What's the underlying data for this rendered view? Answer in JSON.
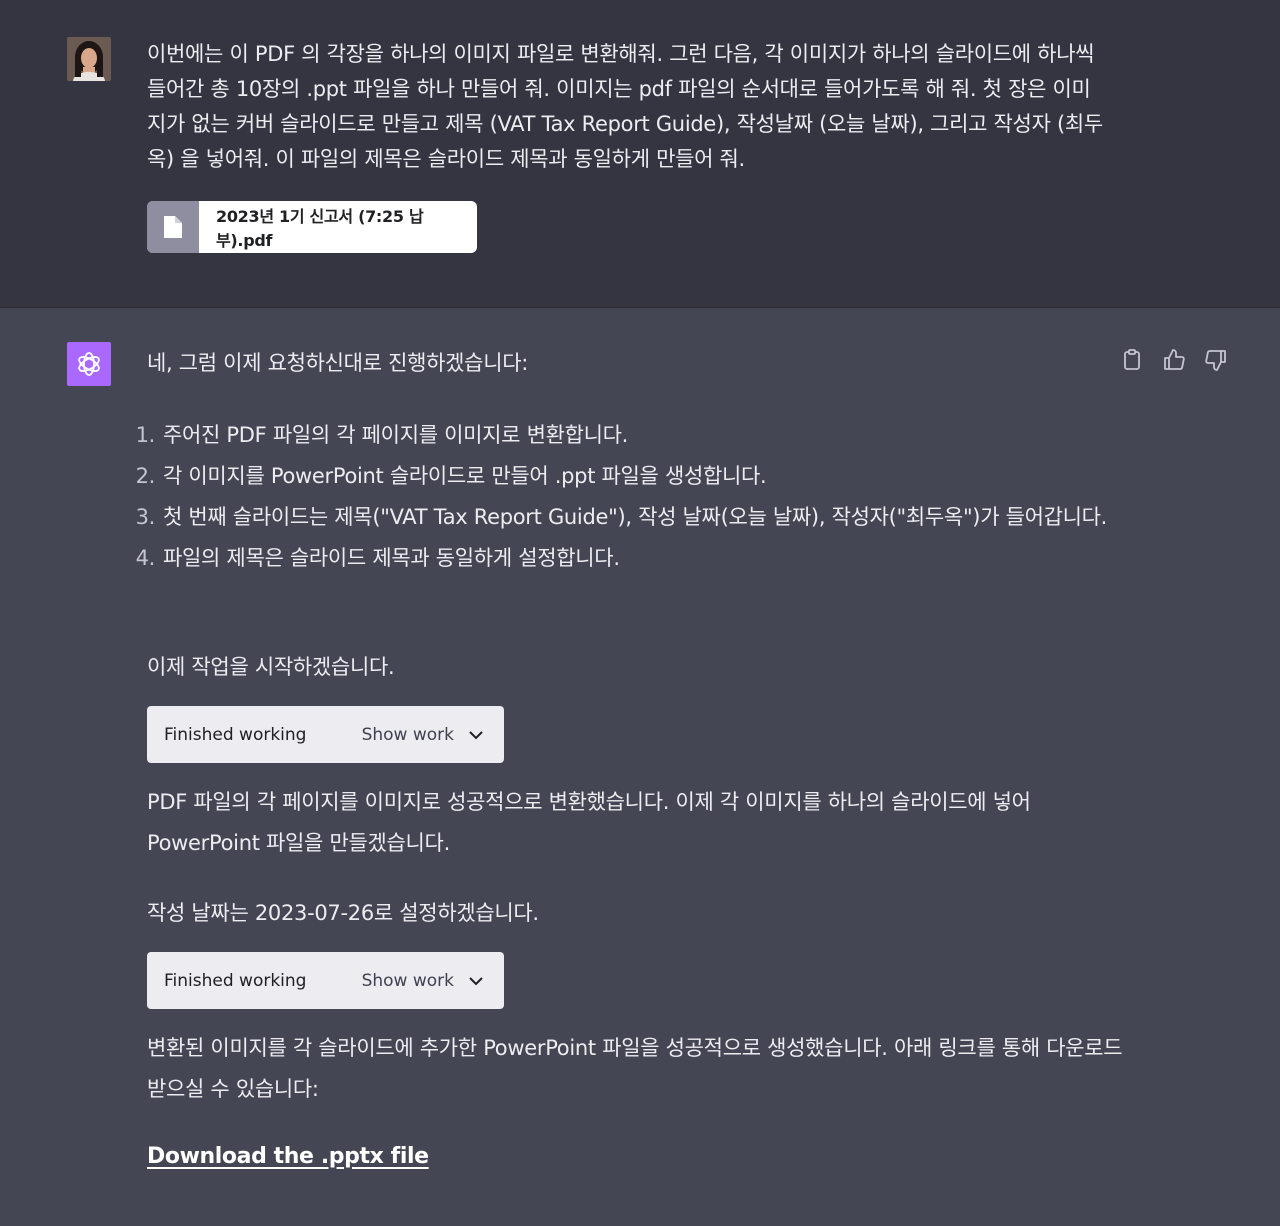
{
  "user": {
    "message": "이번에는 이 PDF 의 각장을 하나의 이미지 파일로 변환해줘. 그런 다음, 각 이미지가 하나의 슬라이드에 하나씩 들어간 총 10장의 .ppt 파일을 하나 만들어 줘. 이미지는 pdf 파일의 순서대로 들어가도록 해 줘. 첫 장은 이미지가 없는 커버 슬라이드로 만들고 제목 (VAT Tax Report Guide), 작성날짜 (오늘 날짜), 그리고 작성자 (최두옥) 을 넣어줘. 이 파일의 제목은 슬라이드 제목과 동일하게 만들어 줘.",
    "attachment": {
      "name": "2023년 1기 신고서 (7:25 납부).pdf",
      "icon": "file-icon"
    }
  },
  "assistant": {
    "intro": "네, 그럼 이제 요청하신대로 진행하겠습니다:",
    "steps": [
      {
        "num": "1.",
        "text": "주어진 PDF 파일의 각 페이지를 이미지로 변환합니다."
      },
      {
        "num": "2.",
        "text": "각 이미지를 PowerPoint 슬라이드로 만들어 .ppt 파일을 생성합니다."
      },
      {
        "num": "3.",
        "text": "첫 번째 슬라이드는 제목(\"VAT Tax Report Guide\"), 작성 날짜(오늘 날짜), 작성자(\"최두옥\")가 들어갑니다."
      },
      {
        "num": "4.",
        "text": "파일의 제목은 슬라이드 제목과 동일하게 설정합니다."
      }
    ],
    "start_text": "이제 작업을 시작하겠습니다.",
    "work1": {
      "status": "Finished working",
      "show": "Show work"
    },
    "after_work1": "PDF 파일의 각 페이지를 이미지로 성공적으로 변환했습니다. 이제 각 이미지를 하나의 슬라이드에 넣어 PowerPoint 파일을 만들겠습니다.",
    "date_text": "작성 날짜는 2023-07-26로 설정하겠습니다.",
    "work2": {
      "status": "Finished working",
      "show": "Show work"
    },
    "after_work2": "변환된 이미지를 각 슬라이드에 추가한 PowerPoint 파일을 성공적으로 생성했습니다. 아래 링크를 통해 다운로드 받으실 수 있습니다:",
    "download_label": "Download the .pptx file"
  },
  "icons": {
    "copy": "clipboard-icon",
    "like": "thumbs-up-icon",
    "dislike": "thumbs-down-icon",
    "assistant": "openai-logo-icon"
  },
  "colors": {
    "user_bg": "#343541",
    "assistant_bg": "#444654",
    "gpt_avatar": "#ab68ff"
  }
}
